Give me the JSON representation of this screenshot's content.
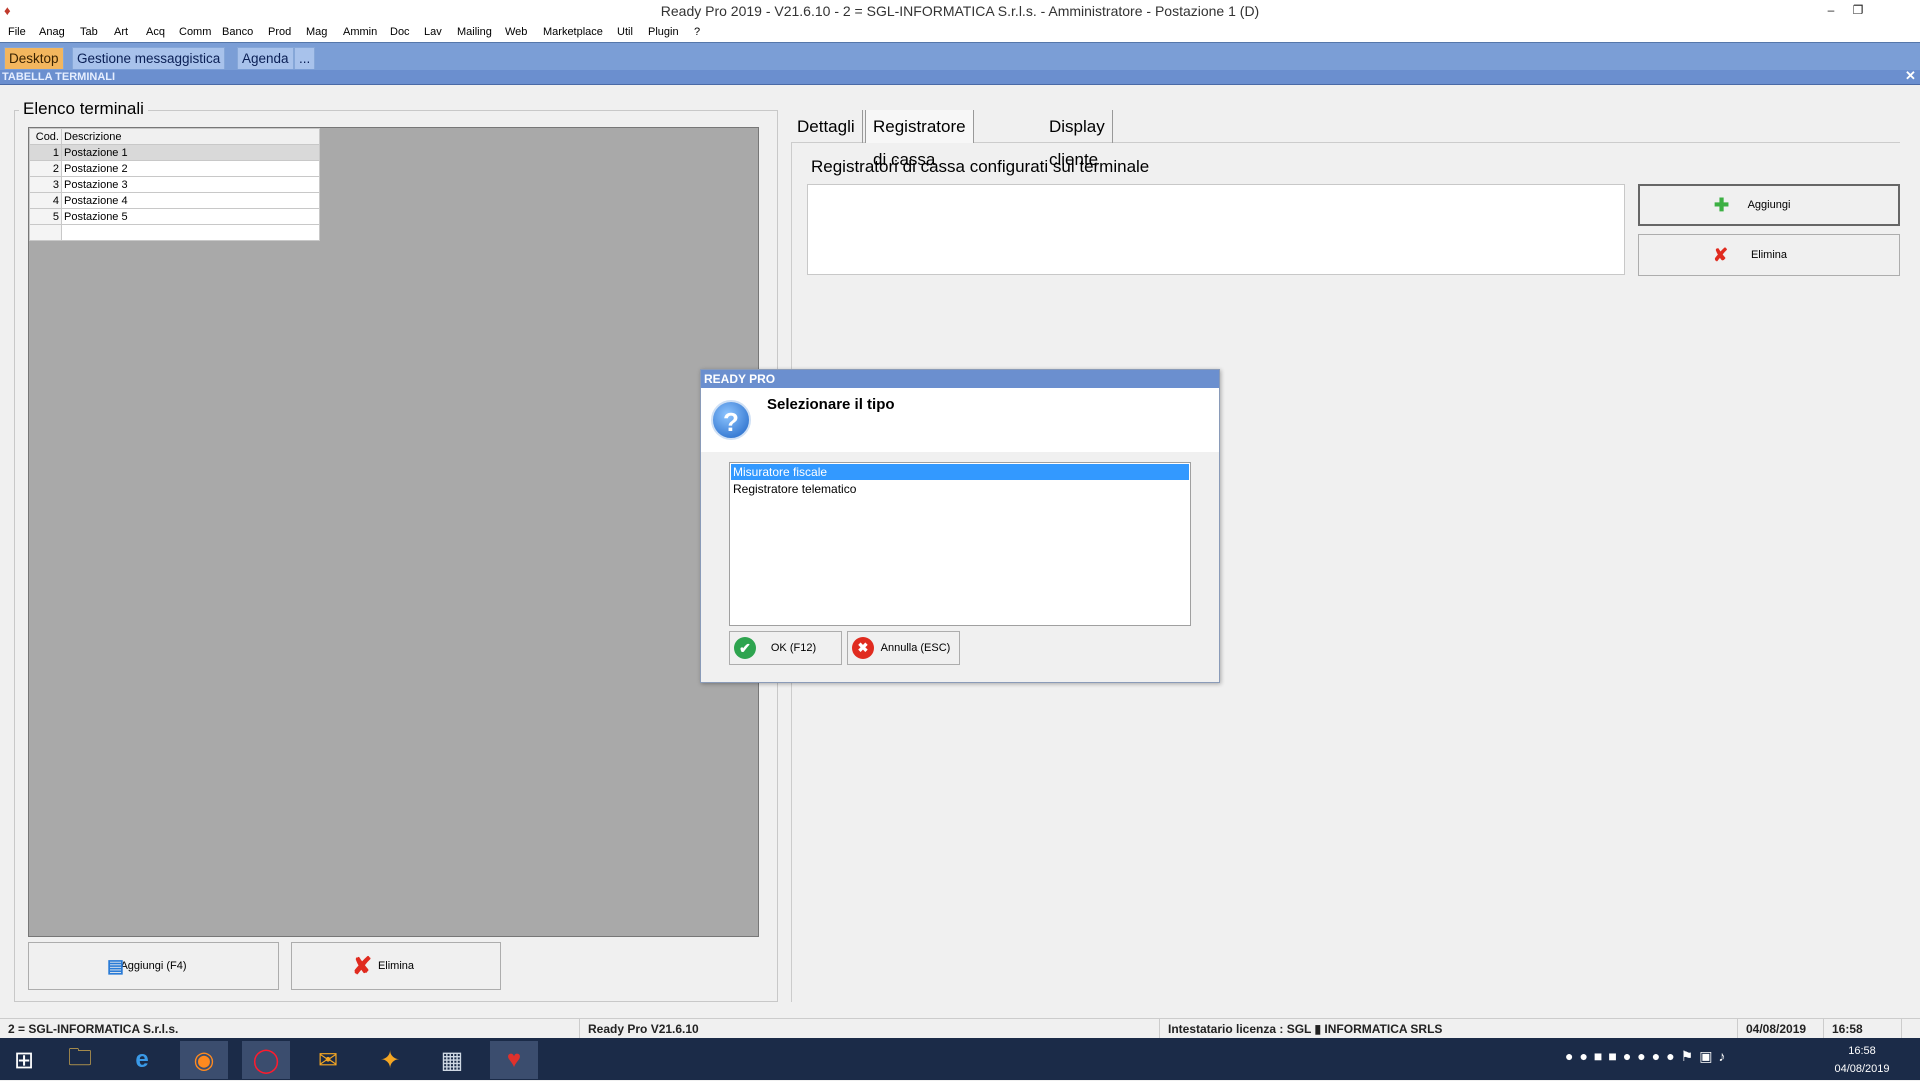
{
  "window": {
    "title": "Ready Pro 2019 - V21.6.10 - 2 = SGL-INFORMATICA S.r.l.s. - Amministratore - Postazione 1 (D)",
    "minimize": "–",
    "restore": "❐"
  },
  "menu": [
    "File",
    "Anag",
    "Tab",
    "Art",
    "Acq",
    "Comm",
    "Banco",
    "Prod",
    "Mag",
    "Ammin",
    "Doc",
    "Lav",
    "Mailing",
    "Web",
    "Marketplace",
    "Util",
    "Plugin",
    "?"
  ],
  "tabs": [
    "Desktop",
    "Gestione messaggistica",
    "Agenda",
    "..."
  ],
  "section": {
    "title": "TABELLA TERMINALI",
    "close": "✕"
  },
  "left": {
    "group_title": "Elenco terminali",
    "columns": [
      "Cod.",
      "Descrizione"
    ],
    "rows": [
      {
        "code": "1",
        "desc": "Postazione 1"
      },
      {
        "code": "2",
        "desc": "Postazione 2"
      },
      {
        "code": "3",
        "desc": "Postazione 3"
      },
      {
        "code": "4",
        "desc": "Postazione 4"
      },
      {
        "code": "5",
        "desc": "Postazione 5"
      }
    ],
    "add_label": "Aggiungi (F4)",
    "delete_label": "Elimina"
  },
  "right": {
    "tabs": [
      "Dettagli",
      "Registratore di cassa",
      "Display cliente"
    ],
    "list_title": "Registratori di cassa configurati sul terminale",
    "add_label": "Aggiungi",
    "delete_label": "Elimina"
  },
  "dialog": {
    "title": "READY PRO",
    "prompt": "Selezionare il tipo",
    "options": [
      "Misuratore fiscale",
      "Registratore telematico"
    ],
    "selected": "Misuratore fiscale",
    "ok_label": "OK (F12)",
    "cancel_label": "Annulla (ESC)"
  },
  "status": {
    "company": "2 = SGL-INFORMATICA S.r.l.s.",
    "version": "Ready Pro V21.6.10",
    "license": "Intestatario licenza : SGL ▮ INFORMATICA SRLS",
    "date": "04/08/2019",
    "time": "16:58"
  },
  "taskbar": {
    "clock_time": "16:58",
    "clock_date": "04/08/2019"
  },
  "colors": {
    "accent": "#7b9ed6",
    "selection": "#3399ff",
    "active_tab": "#f3b65e"
  }
}
